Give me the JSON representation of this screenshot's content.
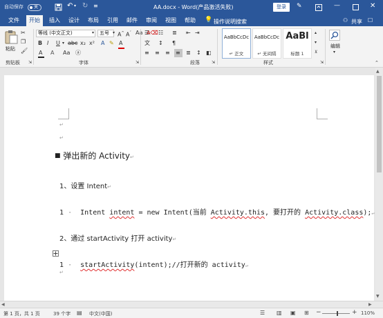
{
  "titlebar": {
    "autosave_label": "自动保存",
    "autosave_state": "关",
    "doc_title": "AA.docx - Word(产品激活失败)",
    "login_button": "登录"
  },
  "tabs": [
    "文件",
    "开始",
    "插入",
    "设计",
    "布局",
    "引用",
    "邮件",
    "审阅",
    "视图",
    "帮助"
  ],
  "active_tab": "开始",
  "tell_me": "操作说明搜索",
  "share": "共享",
  "ribbon": {
    "clipboard": {
      "paste": "粘贴",
      "label": "剪贴板"
    },
    "font": {
      "name": "等线 (中文正文)",
      "size": "五号",
      "label": "字体"
    },
    "paragraph": {
      "label": "段落"
    },
    "styles": {
      "label": "样式",
      "items": [
        {
          "sample": "AaBbCcDc",
          "name": "↵ 正文"
        },
        {
          "sample": "AaBbCcDc",
          "name": "↵ 无间隔"
        },
        {
          "sample": "AaBl",
          "name": "标题 1"
        }
      ]
    },
    "editing": {
      "label": "编辑"
    }
  },
  "document": {
    "heading": "弹出新的 Activity",
    "item1_title": "1、设置 Intent",
    "code1": {
      "num": "1",
      "part1": "Intent ",
      "var": "intent",
      "part2": " = new Intent(当前 ",
      "this_ref": "Activity.this",
      "part3": ", 要打开的 ",
      "class_ref": "Activity.class",
      "part4": ");"
    },
    "item2_title": "2、通过 startActivity 打开 activity",
    "code2": {
      "num": "1",
      "method": "startActivity",
      "rest": "(intent);//打开新的 activity"
    }
  },
  "status": {
    "page": "第 1 页，共 1 页",
    "words": "39 个字",
    "language": "中文(中国)",
    "zoom": "110%"
  }
}
